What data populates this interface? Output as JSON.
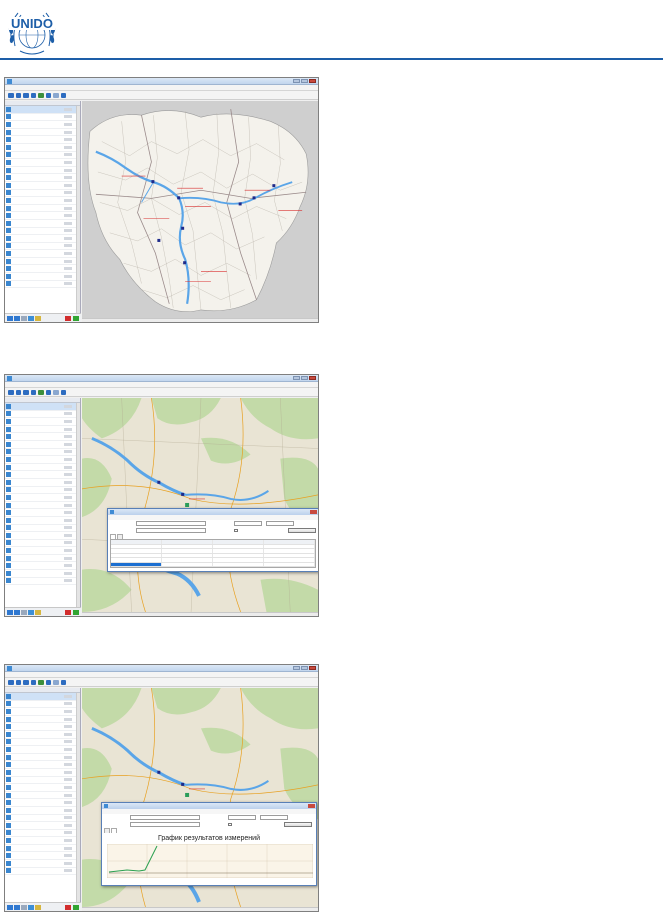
{
  "header": {
    "logo_text": "UNIDO",
    "logo_label": "unido-logo"
  },
  "colors": {
    "rule": "#1d5ea8",
    "logo_blue": "#1d5ea8",
    "river": "#5aa5e8",
    "label_red": "#d93030"
  },
  "screenshots": [
    {
      "window_title": "",
      "menu": [],
      "map_style": "vector-districts",
      "has_dialog": false,
      "scale_text": ""
    },
    {
      "window_title": "",
      "menu": [],
      "map_style": "topographic",
      "has_dialog": true,
      "dialog_view": "table",
      "scale_text": ""
    },
    {
      "window_title": "",
      "menu": [],
      "map_style": "topographic",
      "has_dialog": true,
      "dialog_view": "chart",
      "scale_text": ""
    }
  ],
  "chart_panel": {
    "title": "График результатов измерений"
  }
}
